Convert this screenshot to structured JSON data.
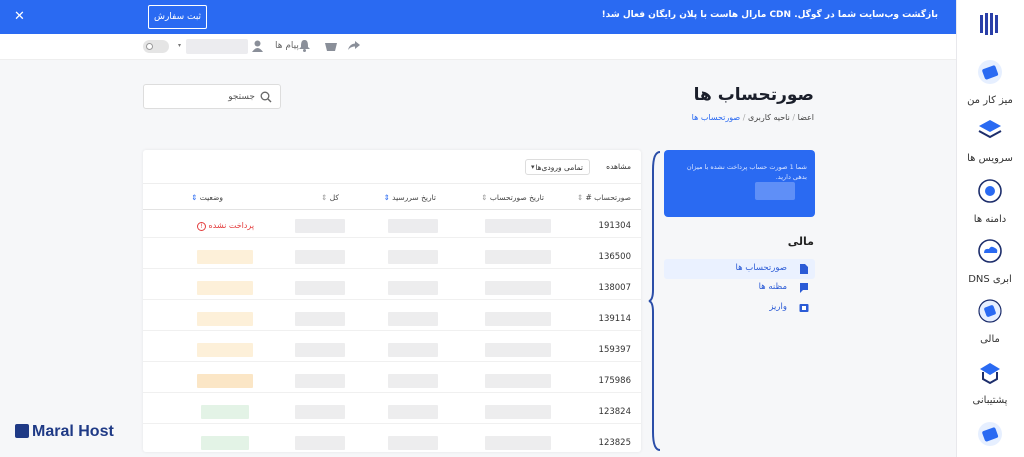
{
  "banner": {
    "message": "بازگشت وب‌سایت شما در گوگل. CDN مارال هاست با پلان رایگان فعال شد!",
    "button_label": "ثبت سفارش",
    "close_glyph": "✕"
  },
  "header": {
    "messages_label": "پیام ها"
  },
  "sidebar": {
    "items": [
      {
        "label": "میز کار من",
        "icon": "desk-icon"
      },
      {
        "label": "سرویس ها",
        "icon": "layers-icon"
      },
      {
        "label": "دامنه ها",
        "icon": "globe-icon"
      },
      {
        "label": "DNS ابری",
        "icon": "cloud-dns-icon"
      },
      {
        "label": "مالی",
        "icon": "finance-icon"
      },
      {
        "label": "پشتیبانی",
        "icon": "support-icon"
      }
    ]
  },
  "page": {
    "title": "صورتحساب ها",
    "breadcrumb": [
      "اعضا",
      "ناحیه کاربری",
      "صورتحساب ها"
    ],
    "search_placeholder": "جستجو"
  },
  "due_card": {
    "text": "شما 1 صورت حساب پرداخت نشده با میزان بدهی دارید."
  },
  "finance": {
    "title": "مالی",
    "items": [
      "صورتحساب ها",
      "مظنه ها",
      "واریز"
    ]
  },
  "table": {
    "filter_label": "مشاهده",
    "filter_value": "تمامی ورودی‌ها",
    "filter_caret": "▾",
    "columns": [
      "صورتحساب #",
      "تاریخ صورتحساب",
      "تاریخ سررسید",
      "کل",
      "وضعیت"
    ],
    "rows": [
      {
        "id": "191304",
        "status": "پرداخت نشده"
      },
      {
        "id": "136500"
      },
      {
        "id": "138007"
      },
      {
        "id": "139114"
      },
      {
        "id": "159397"
      },
      {
        "id": "175986"
      },
      {
        "id": "123824"
      },
      {
        "id": "123825"
      }
    ]
  },
  "brand": {
    "name": "Maral Host"
  },
  "colors": {
    "accent": "#2a6af2",
    "unpaid": "#e33d3d"
  }
}
